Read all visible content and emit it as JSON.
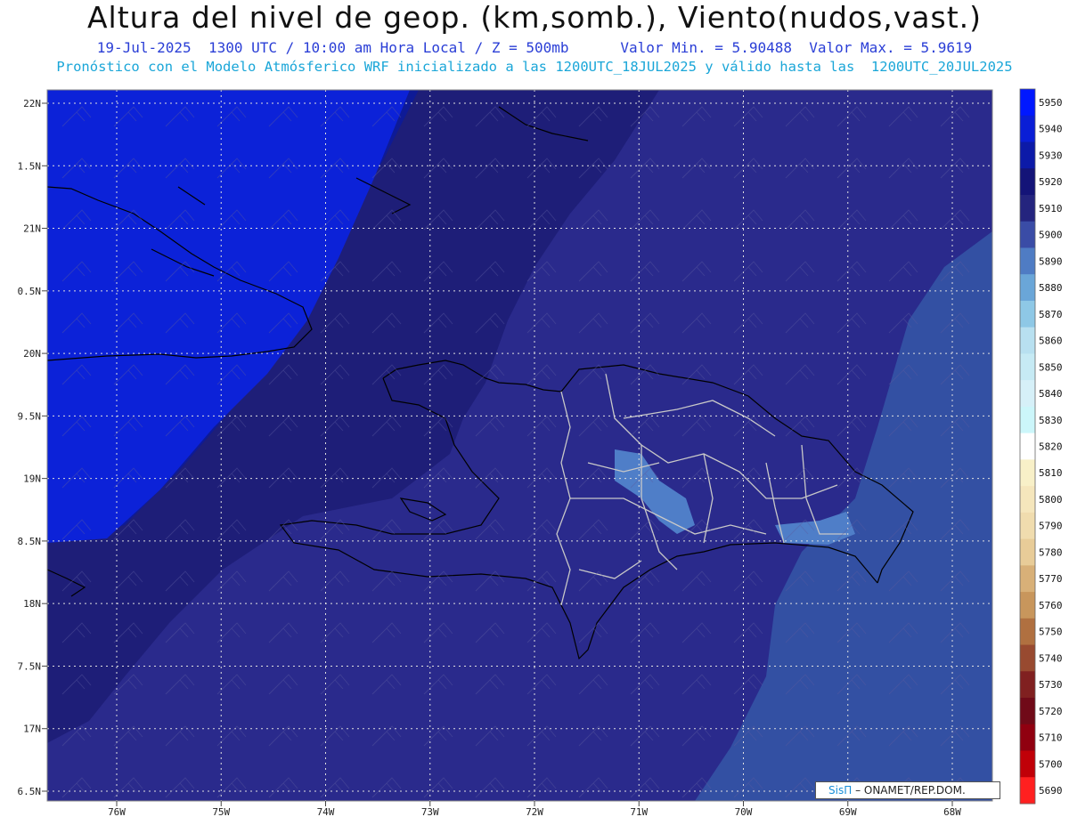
{
  "header": {
    "title": "Altura del nivel de geop. (km,somb.), Viento(nudos,vast.)",
    "subtitle_left": "19-Jul-2025  1300 UTC / 10:00 am Hora Local / Z = 500mb",
    "subtitle_right": "Valor Min. = 5.90488  Valor Max. = 5.9619",
    "model_line": "Pronóstico con el Modelo Atmósferico WRF inicializado a las 1200UTC_18JUL2025 y válido hasta las  1200UTC_20JUL2025"
  },
  "map": {
    "lat_labels": [
      "22N",
      "1.5N",
      "21N",
      "0.5N",
      "20N",
      "9.5N",
      "19N",
      "8.5N",
      "18N",
      "7.5N",
      "17N",
      "6.5N"
    ],
    "lon_labels": [
      "76W",
      "75W",
      "74W",
      "73W",
      "72W",
      "71W",
      "70W",
      "69W",
      "68W"
    ],
    "fill_colors": {
      "z5940": "#0c22d8",
      "z5930": "#0e1a96",
      "z5920": "#1e1e78",
      "z5910": "#2a2a8c",
      "z5900": "#3350a3",
      "z5890": "#4f7ec8"
    },
    "coastline_color": "#000000",
    "province_border_color": "#c8c8c8"
  },
  "colorbar": {
    "levels": [
      "5950",
      "5940",
      "5930",
      "5920",
      "5910",
      "5900",
      "5890",
      "5880",
      "5870",
      "5860",
      "5850",
      "5840",
      "5830",
      "5820",
      "5810",
      "5800",
      "5790",
      "5780",
      "5770",
      "5760",
      "5750",
      "5740",
      "5730",
      "5720",
      "5710",
      "5700",
      "5690"
    ],
    "colors": [
      "#0018ff",
      "#0a1ed6",
      "#0c1aa8",
      "#141478",
      "#24247e",
      "#3a4ca6",
      "#4f7cc4",
      "#6aa6d8",
      "#8ec8e6",
      "#b8e0f0",
      "#c6eaf4",
      "#d6f0f8",
      "#ccf6fa",
      "#ffffff",
      "#f8f0c8",
      "#f5e6bc",
      "#f0dcae",
      "#e8cc98",
      "#d8b078",
      "#c8965c",
      "#b07040",
      "#984a30",
      "#802020",
      "#700a18",
      "#900010",
      "#c00008",
      "#ff2020"
    ]
  },
  "credit": {
    "brand": "SisΠ",
    "text": "– ONAMET/REP.DOM."
  }
}
